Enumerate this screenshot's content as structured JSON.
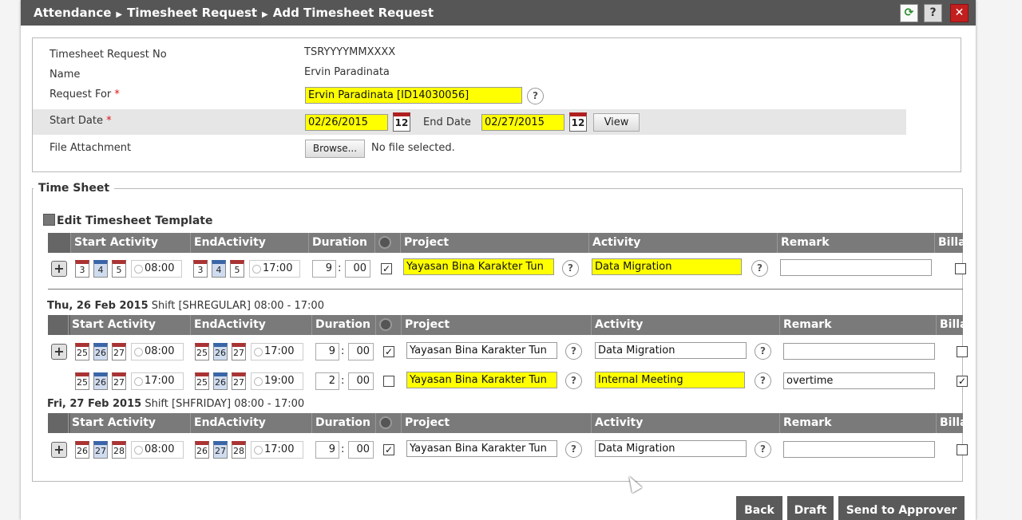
{
  "breadcrumb": [
    "Attendance",
    "Timesheet Request",
    "Add Timesheet Request"
  ],
  "window_buttons": {
    "refresh_icon": "refresh-icon",
    "help": "?",
    "close": "✕"
  },
  "form": {
    "request_no_label": "Timesheet Request No",
    "request_no_value": "TSRYYYYMMXXXX",
    "name_label": "Name",
    "name_value": "Ervin Paradinata",
    "request_for_label": "Request For",
    "request_for_value": "Ervin Paradinata [ID14030056]",
    "required_mark": "*",
    "start_date_label": "Start Date",
    "start_date_value": "02/26/2015",
    "end_date_label": "End Date",
    "end_date_value": "02/27/2015",
    "calendar_day": "12",
    "view_button": "View",
    "file_label": "File Attachment",
    "browse_button": "Browse...",
    "no_file": "No file selected.",
    "help_mark": "?"
  },
  "timesheet": {
    "legend": "Time Sheet",
    "edit_template": "Edit Timesheet Template",
    "headers": {
      "start": "Start Activity",
      "end": "EndActivity",
      "duration": "Duration",
      "project": "Project",
      "activity": "Activity",
      "remark": "Remark",
      "billable": "Billa"
    },
    "template_row": {
      "s1": "3",
      "s2": "4",
      "s3": "5",
      "start_time": "08:00",
      "e1": "3",
      "e2": "4",
      "e3": "5",
      "end_time": "17:00",
      "hours": "9",
      "minutes": "00",
      "project": "Yayasan Bina Karakter Tun",
      "activity": "Data Migration",
      "remark": ""
    },
    "days": [
      {
        "date": "Thu, 26 Feb 2015",
        "shift": "Shift [SHREGULAR] 08:00 - 17:00",
        "rows": [
          {
            "s1": "25",
            "s2": "26",
            "s3": "27",
            "start_time": "08:00",
            "e1": "25",
            "e2": "26",
            "e3": "27",
            "end_time": "17:00",
            "hours": "9",
            "minutes": "00",
            "project": "Yayasan Bina Karakter Tun",
            "activity": "Data Migration",
            "remark": ""
          },
          {
            "s1": "25",
            "s2": "26",
            "s3": "27",
            "start_time": "17:00",
            "e1": "25",
            "e2": "26",
            "e3": "27",
            "end_time": "19:00",
            "hours": "2",
            "minutes": "00",
            "project": "Yayasan Bina Karakter Tun",
            "activity": "Internal Meeting",
            "remark": "overtime"
          }
        ]
      },
      {
        "date": "Fri, 27 Feb 2015",
        "shift": "Shift [SHFRIDAY] 08:00 - 17:00",
        "rows": [
          {
            "s1": "26",
            "s2": "27",
            "s3": "28",
            "start_time": "08:00",
            "e1": "26",
            "e2": "27",
            "e3": "28",
            "end_time": "17:00",
            "hours": "9",
            "minutes": "00",
            "project": "Yayasan Bina Karakter Tun",
            "activity": "Data Migration",
            "remark": ""
          }
        ]
      }
    ]
  },
  "footer": {
    "back": "Back",
    "draft": "Draft",
    "send": "Send to Approver"
  },
  "colors": {
    "titlebar": "#565656",
    "highlight": "#ffff00",
    "header": "#7a7a7a",
    "close": "#c21f1f"
  }
}
